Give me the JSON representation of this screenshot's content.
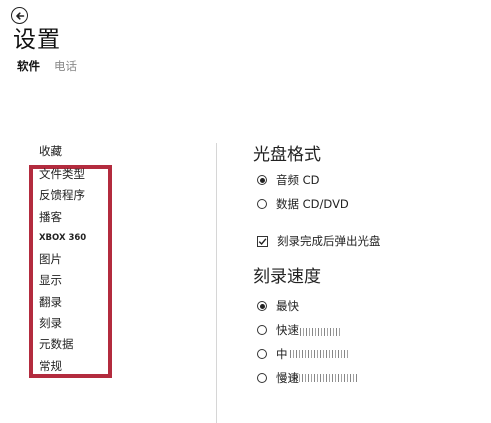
{
  "header": {
    "back_icon": "arrow-left-circle-icon",
    "title": "设置",
    "tabs": [
      {
        "label": "软件",
        "active": true
      },
      {
        "label": "电话",
        "active": false
      }
    ]
  },
  "sidebar": {
    "top_item": "收藏",
    "items": [
      {
        "label": "文件类型"
      },
      {
        "label": "反馈程序"
      },
      {
        "label": "播客"
      },
      {
        "label": "XBOX 360"
      },
      {
        "label": "图片"
      },
      {
        "label": "显示"
      },
      {
        "label": "翻录"
      },
      {
        "label": "刻录"
      },
      {
        "label": "元数据"
      },
      {
        "label": "常规"
      }
    ],
    "highlight_color": "#b32b3e"
  },
  "content": {
    "disc_format": {
      "title": "光盘格式",
      "options": [
        {
          "label": "音频 CD",
          "checked": true
        },
        {
          "label": "数据 CD/DVD",
          "checked": false
        }
      ],
      "eject_checkbox": {
        "label": "刻录完成后弹出光盘",
        "checked": true
      }
    },
    "burn_speed": {
      "title": "刻录速度",
      "options": [
        {
          "label": "最快",
          "checked": true
        },
        {
          "label": "快速",
          "checked": false
        },
        {
          "label": "中",
          "checked": false
        },
        {
          "label": "慢速",
          "checked": false
        }
      ]
    }
  }
}
